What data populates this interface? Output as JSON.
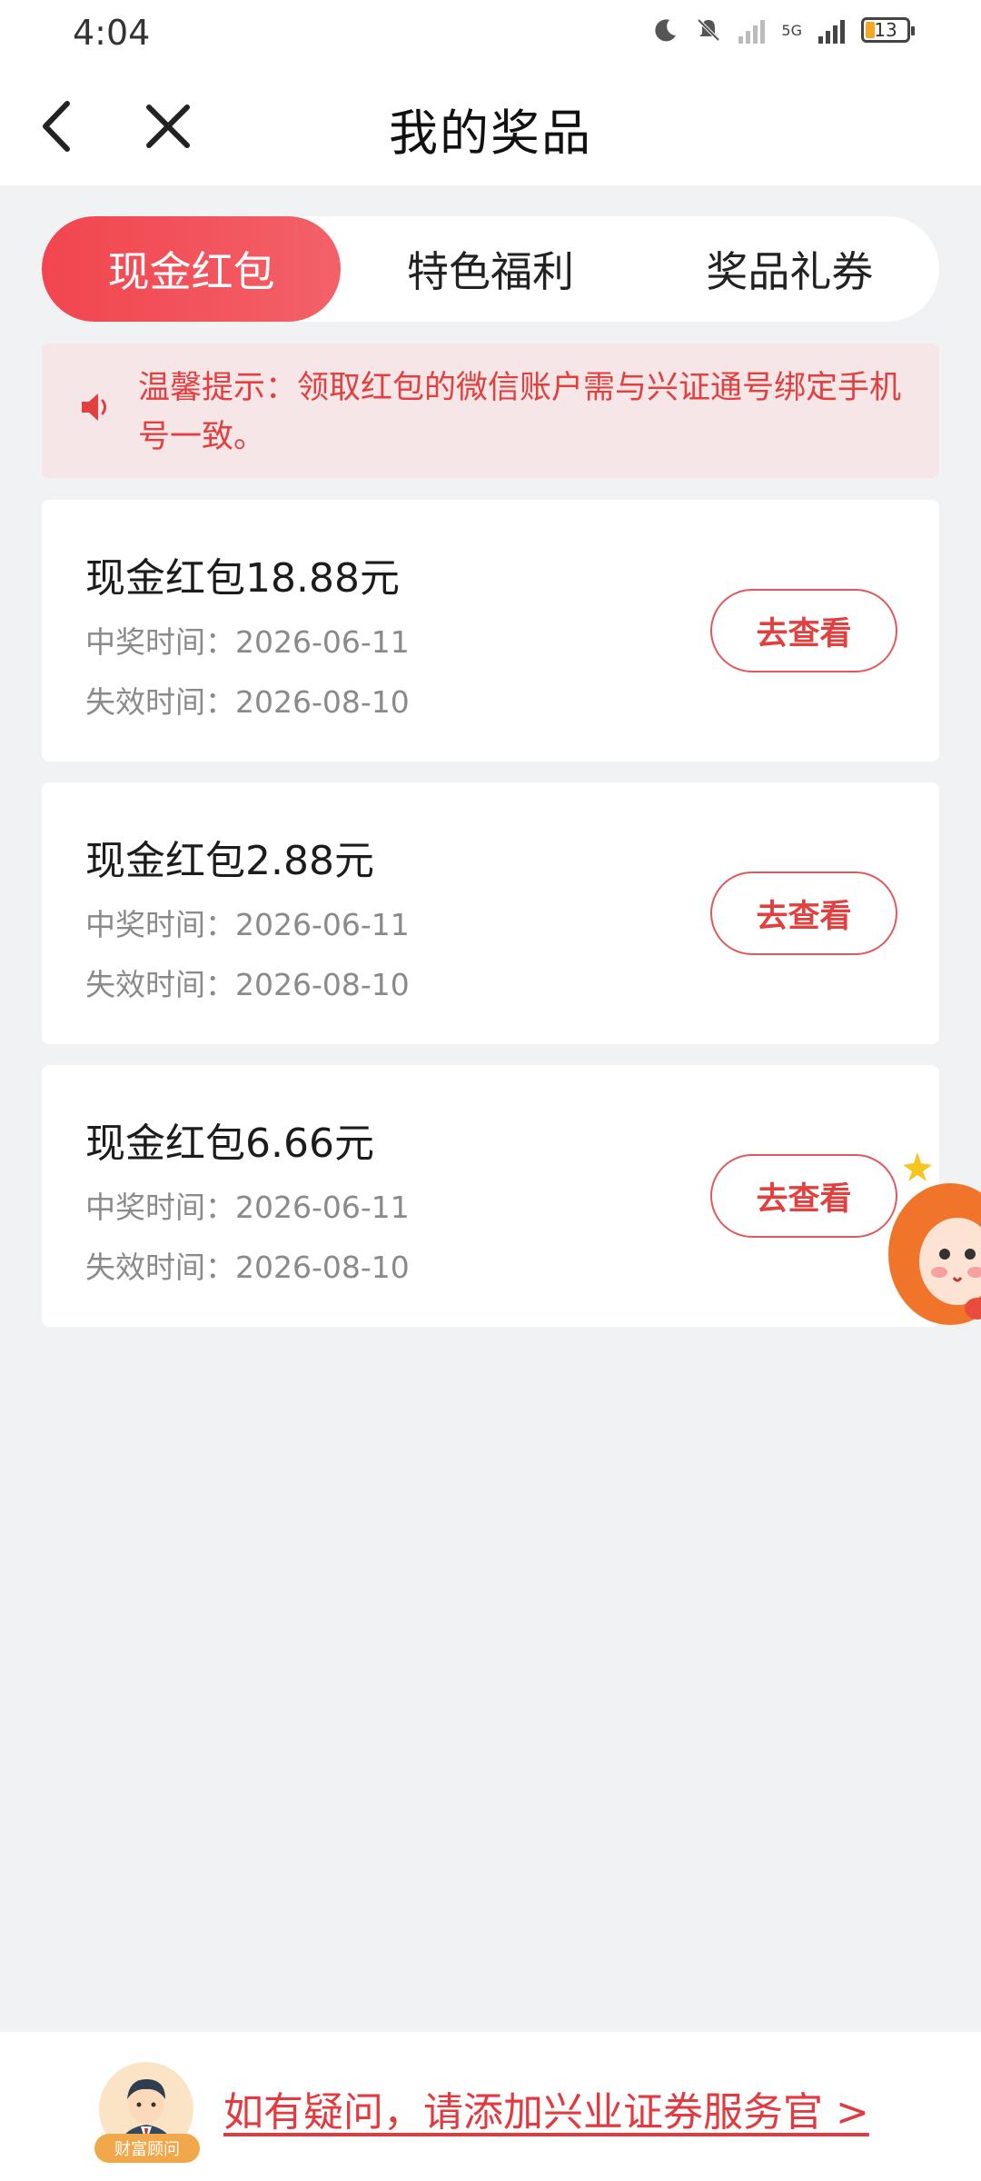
{
  "status_bar": {
    "time": "4:04",
    "battery": "13",
    "network": "5G"
  },
  "nav": {
    "title": "我的奖品"
  },
  "tabs": [
    {
      "label": "现金红包",
      "active": true
    },
    {
      "label": "特色福利",
      "active": false
    },
    {
      "label": "奖品礼券",
      "active": false
    }
  ],
  "notice": {
    "text": "温馨提示：领取红包的微信账户需与兴证通号绑定手机号一致。"
  },
  "prizes": [
    {
      "title": "现金红包18.88元",
      "win_time": "中奖时间：2026-06-11",
      "expire_time": "失效时间：2026-08-10",
      "button": "去查看"
    },
    {
      "title": "现金红包2.88元",
      "win_time": "中奖时间：2026-06-11",
      "expire_time": "失效时间：2026-08-10",
      "button": "去查看"
    },
    {
      "title": "现金红包6.66元",
      "win_time": "中奖时间：2026-06-11",
      "expire_time": "失效时间：2026-08-10",
      "button": "去查看"
    }
  ],
  "footer": {
    "advisor_tag": "财富顾问",
    "link_text": "如有疑问，请添加兴业证券服务官 >"
  },
  "colors": {
    "accent": "#f2454f",
    "accent_text": "#e2403f",
    "notice_bg": "#f6e6e8",
    "page_bg": "#f1f2f4"
  }
}
